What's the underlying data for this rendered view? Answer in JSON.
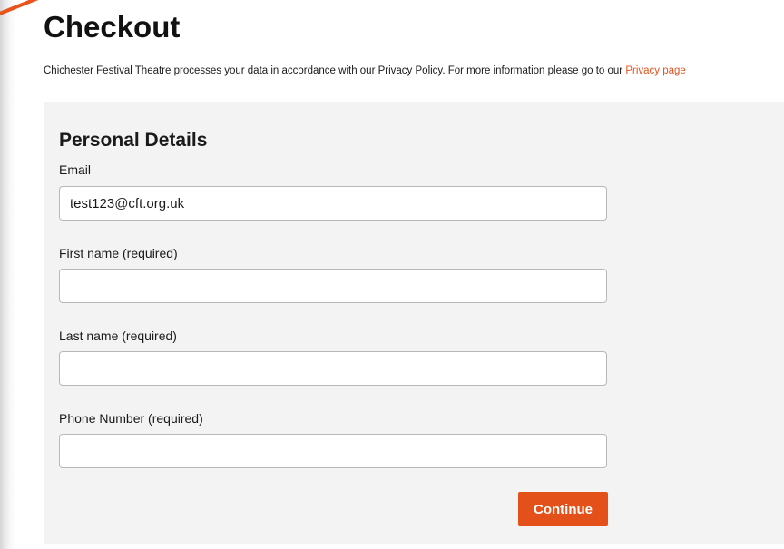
{
  "page": {
    "title": "Checkout",
    "privacy_notice": "Chichester Festival Theatre processes your data in accordance with our Privacy Policy. For more information please go to our ",
    "privacy_link": "Privacy page"
  },
  "form": {
    "section_title": "Personal Details",
    "fields": [
      {
        "label": "Email",
        "value": "test123@cft.org.uk"
      },
      {
        "label": "First name (required)",
        "value": ""
      },
      {
        "label": "Last name (required)",
        "value": ""
      },
      {
        "label": "Phone Number (required)",
        "value": ""
      }
    ],
    "continue_label": "Continue"
  },
  "colors": {
    "accent": "#e4501a",
    "link": "#e8541e",
    "panel_background": "#f3f3f3",
    "annotation": "#e8541e"
  }
}
